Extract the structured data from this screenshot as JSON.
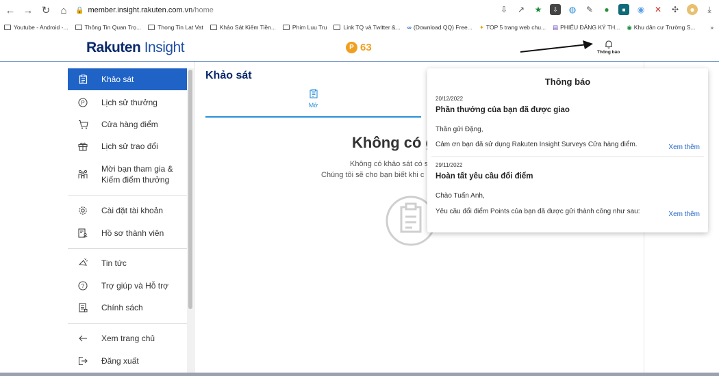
{
  "browser": {
    "url_host": "member.insight.rakuten.com.vn",
    "url_path": "/home",
    "bookmarks": [
      "Youtube - Android -...",
      "Thông Tin Quan Trọ...",
      "Thong Tin Lat Vat",
      "Khảo Sát Kiếm Tiền...",
      "Phim Luu Tru",
      "Link TQ và Twitter &...",
      "(Download QQ) Free...",
      "TOP 5 trang web chu...",
      "PHIẾU ĐĂNG KÝ TH...",
      "Khu dân cư Trường S..."
    ],
    "more": "»"
  },
  "header": {
    "logo_bold": "Rakuten",
    "logo_thin": "Insight",
    "points_badge": "P",
    "points": "63",
    "notification_label": "Thông báo"
  },
  "sidebar": {
    "items": [
      {
        "label": "Khảo sát",
        "icon": "clipboard-icon"
      },
      {
        "label": "Lịch sử thưởng",
        "icon": "p-coin-icon"
      },
      {
        "label": "Cửa hàng điểm",
        "icon": "cart-icon"
      },
      {
        "label": "Lịch sử trao đổi",
        "icon": "gift-icon"
      },
      {
        "label": "Mời bạn tham gia &",
        "label2": "Kiếm điểm thưởng",
        "icon": "people-icon"
      },
      {
        "label": "Cài đặt tài khoản",
        "icon": "gear-icon"
      },
      {
        "label": "Hồ sơ thành viên",
        "icon": "profile-icon"
      },
      {
        "label": "Tin tức",
        "icon": "megaphone-icon"
      },
      {
        "label": "Trợ giúp và Hỗ trợ",
        "icon": "help-icon"
      },
      {
        "label": "Chính sách",
        "icon": "document-icon"
      },
      {
        "label": "Xem trang chủ",
        "icon": "arrow-left-icon"
      },
      {
        "label": "Đăng xuất",
        "icon": "logout-icon"
      }
    ]
  },
  "main": {
    "title": "Khảo sát",
    "tab_open": "Mở",
    "empty_title": "Không có g",
    "empty_line1": "Không có khảo sát có s",
    "empty_line2": "Chúng tôi sẽ cho bạn biết khi c"
  },
  "notifications": {
    "title": "Thông báo",
    "items": [
      {
        "date": "20/12/2022",
        "heading": "Phần thưởng của bạn đã được giao",
        "greeting": "Thân gửi Đặng,",
        "body": "Cảm ơn bạn đã sử dụng Rakuten Insight Surveys Cửa hàng điểm.",
        "more": "Xem thêm"
      },
      {
        "date": "29/11/2022",
        "heading": "Hoàn tất yêu cầu đổi điểm",
        "greeting": "Chào Tuấn Anh,",
        "body": "Yêu cầu đổi điểm Points của bạn đã được gửi thành công như sau:",
        "more": "Xem thêm"
      }
    ]
  },
  "colors": {
    "brand_blue": "#0a2a6b",
    "active_blue": "#1f63c7",
    "points_orange": "#f0a020",
    "tab_blue": "#2a8fd8"
  }
}
